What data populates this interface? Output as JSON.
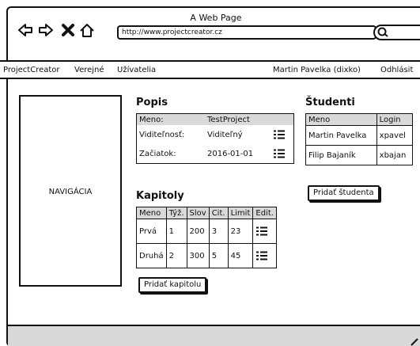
{
  "browser": {
    "title": "A Web Page",
    "url": "http://www.projectcreator.cz",
    "nav_icons": [
      "back-arrow-icon",
      "forward-arrow-icon",
      "close-icon",
      "home-icon"
    ]
  },
  "topnav": {
    "brand": "ProjectCreator",
    "public": "Verejné",
    "users": "Užívatelia",
    "user": "Martin Pavelka (dixko)",
    "logout": "Odhlásit"
  },
  "navigation": {
    "label": "NAVIGÁCIA"
  },
  "popis": {
    "heading": "Popis",
    "header": {
      "col1": "Meno:",
      "col2": "TestProject"
    },
    "rows": [
      {
        "label": "Viditeľnosť:",
        "value": "Viditeľný"
      },
      {
        "label": "Začiatok:",
        "value": "2016-01-01"
      }
    ]
  },
  "studenti": {
    "heading": "Študenti",
    "columns": [
      "Meno",
      "Login"
    ],
    "rows": [
      {
        "name": "Martin Pavelka",
        "login": "xpavel"
      },
      {
        "name": "Filip Bajaník",
        "login": "xbajan"
      }
    ],
    "add_button": "Pridať študenta"
  },
  "kapitoly": {
    "heading": "Kapitoly",
    "columns": [
      "Meno",
      "Týž.",
      "Slov",
      "Cit.",
      "Limit",
      "Edit."
    ],
    "rows": [
      {
        "name": "Prvá",
        "week": "1",
        "words": "200",
        "cit": "3",
        "limit": "23"
      },
      {
        "name": "Druhá",
        "week": "2",
        "words": "300",
        "cit": "5",
        "limit": "45"
      }
    ],
    "add_button": "Pridať kapitolu"
  }
}
